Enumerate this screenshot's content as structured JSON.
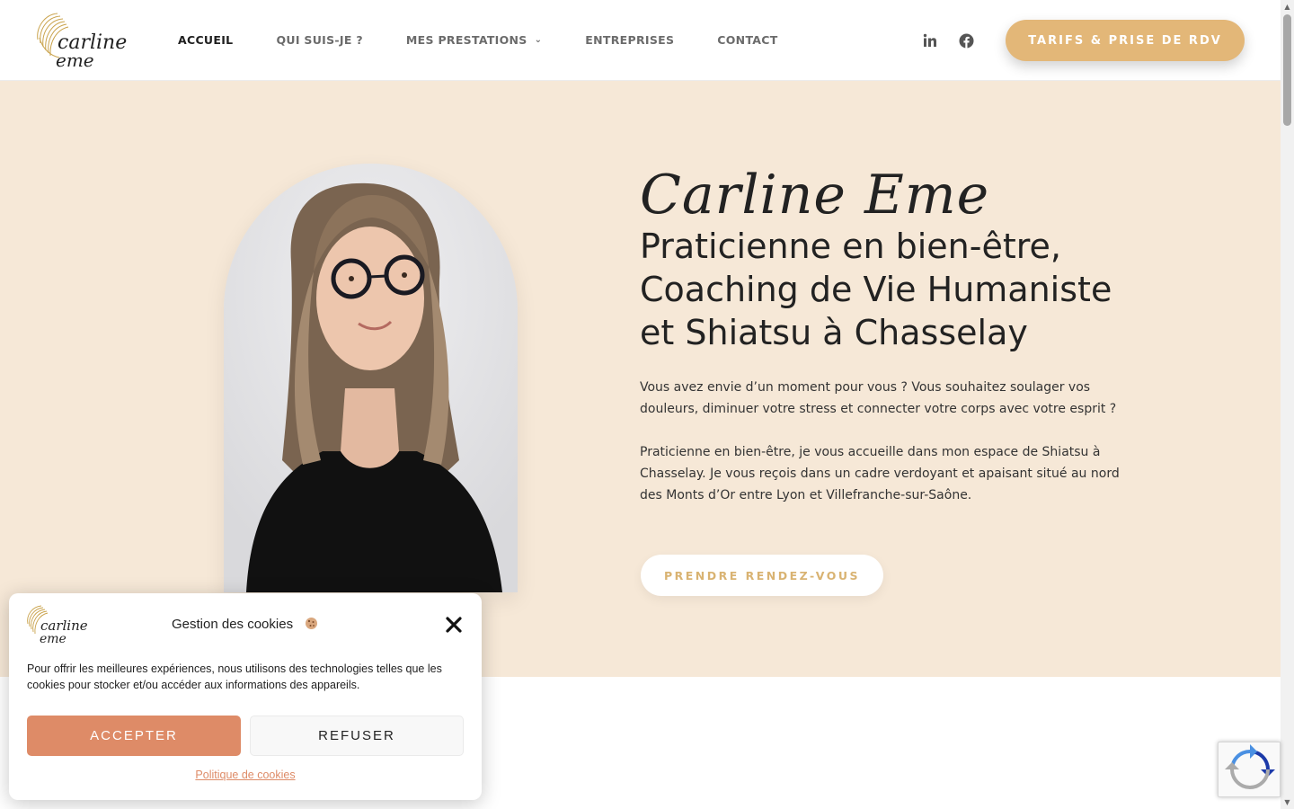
{
  "header": {
    "logo": {
      "line1": "carline",
      "line2": "eme"
    },
    "nav": [
      {
        "label": "ACCUEIL",
        "active": true
      },
      {
        "label": "QUI SUIS-JE ?",
        "active": false
      },
      {
        "label": "MES PRESTATIONS",
        "active": false,
        "has_dropdown": true
      },
      {
        "label": "ENTREPRISES",
        "active": false
      },
      {
        "label": "CONTACT",
        "active": false
      }
    ],
    "social": {
      "linkedin_icon": "linkedin-icon",
      "facebook_icon": "facebook-icon"
    },
    "cta_label": "TARIFS & PRISE DE RDV"
  },
  "hero": {
    "script_name": "Carline Eme",
    "title": "Praticienne en bien-être, Coaching de Vie Humaniste et Shiatsu à Chasselay",
    "p1": "Vous avez envie d’un moment pour vous ? Vous souhaitez soulager vos douleurs, diminuer votre stress et connecter votre corps avec votre esprit ?",
    "p2": "Praticienne en bien-être, je vous accueille dans mon espace de Shiatsu à Chasselay. Je vous reçois dans un cadre verdoyant et apaisant situé au nord des Monts d’Or entre Lyon et Villefranche-sur-Saône.",
    "cta_label": "PRENDRE RENDEZ-VOUS"
  },
  "cookie": {
    "title": "Gestion des cookies",
    "text": "Pour offrir les meilleures expériences, nous utilisons des technologies telles que les cookies pour stocker et/ou accéder aux informations des appareils.",
    "accept_label": "ACCEPTER",
    "refuse_label": "REFUSER",
    "policy_link": "Politique de cookies"
  },
  "colors": {
    "accent_gold": "#e3b778",
    "hero_bg": "#f6e8d7",
    "accept_orange": "#de8b67"
  }
}
